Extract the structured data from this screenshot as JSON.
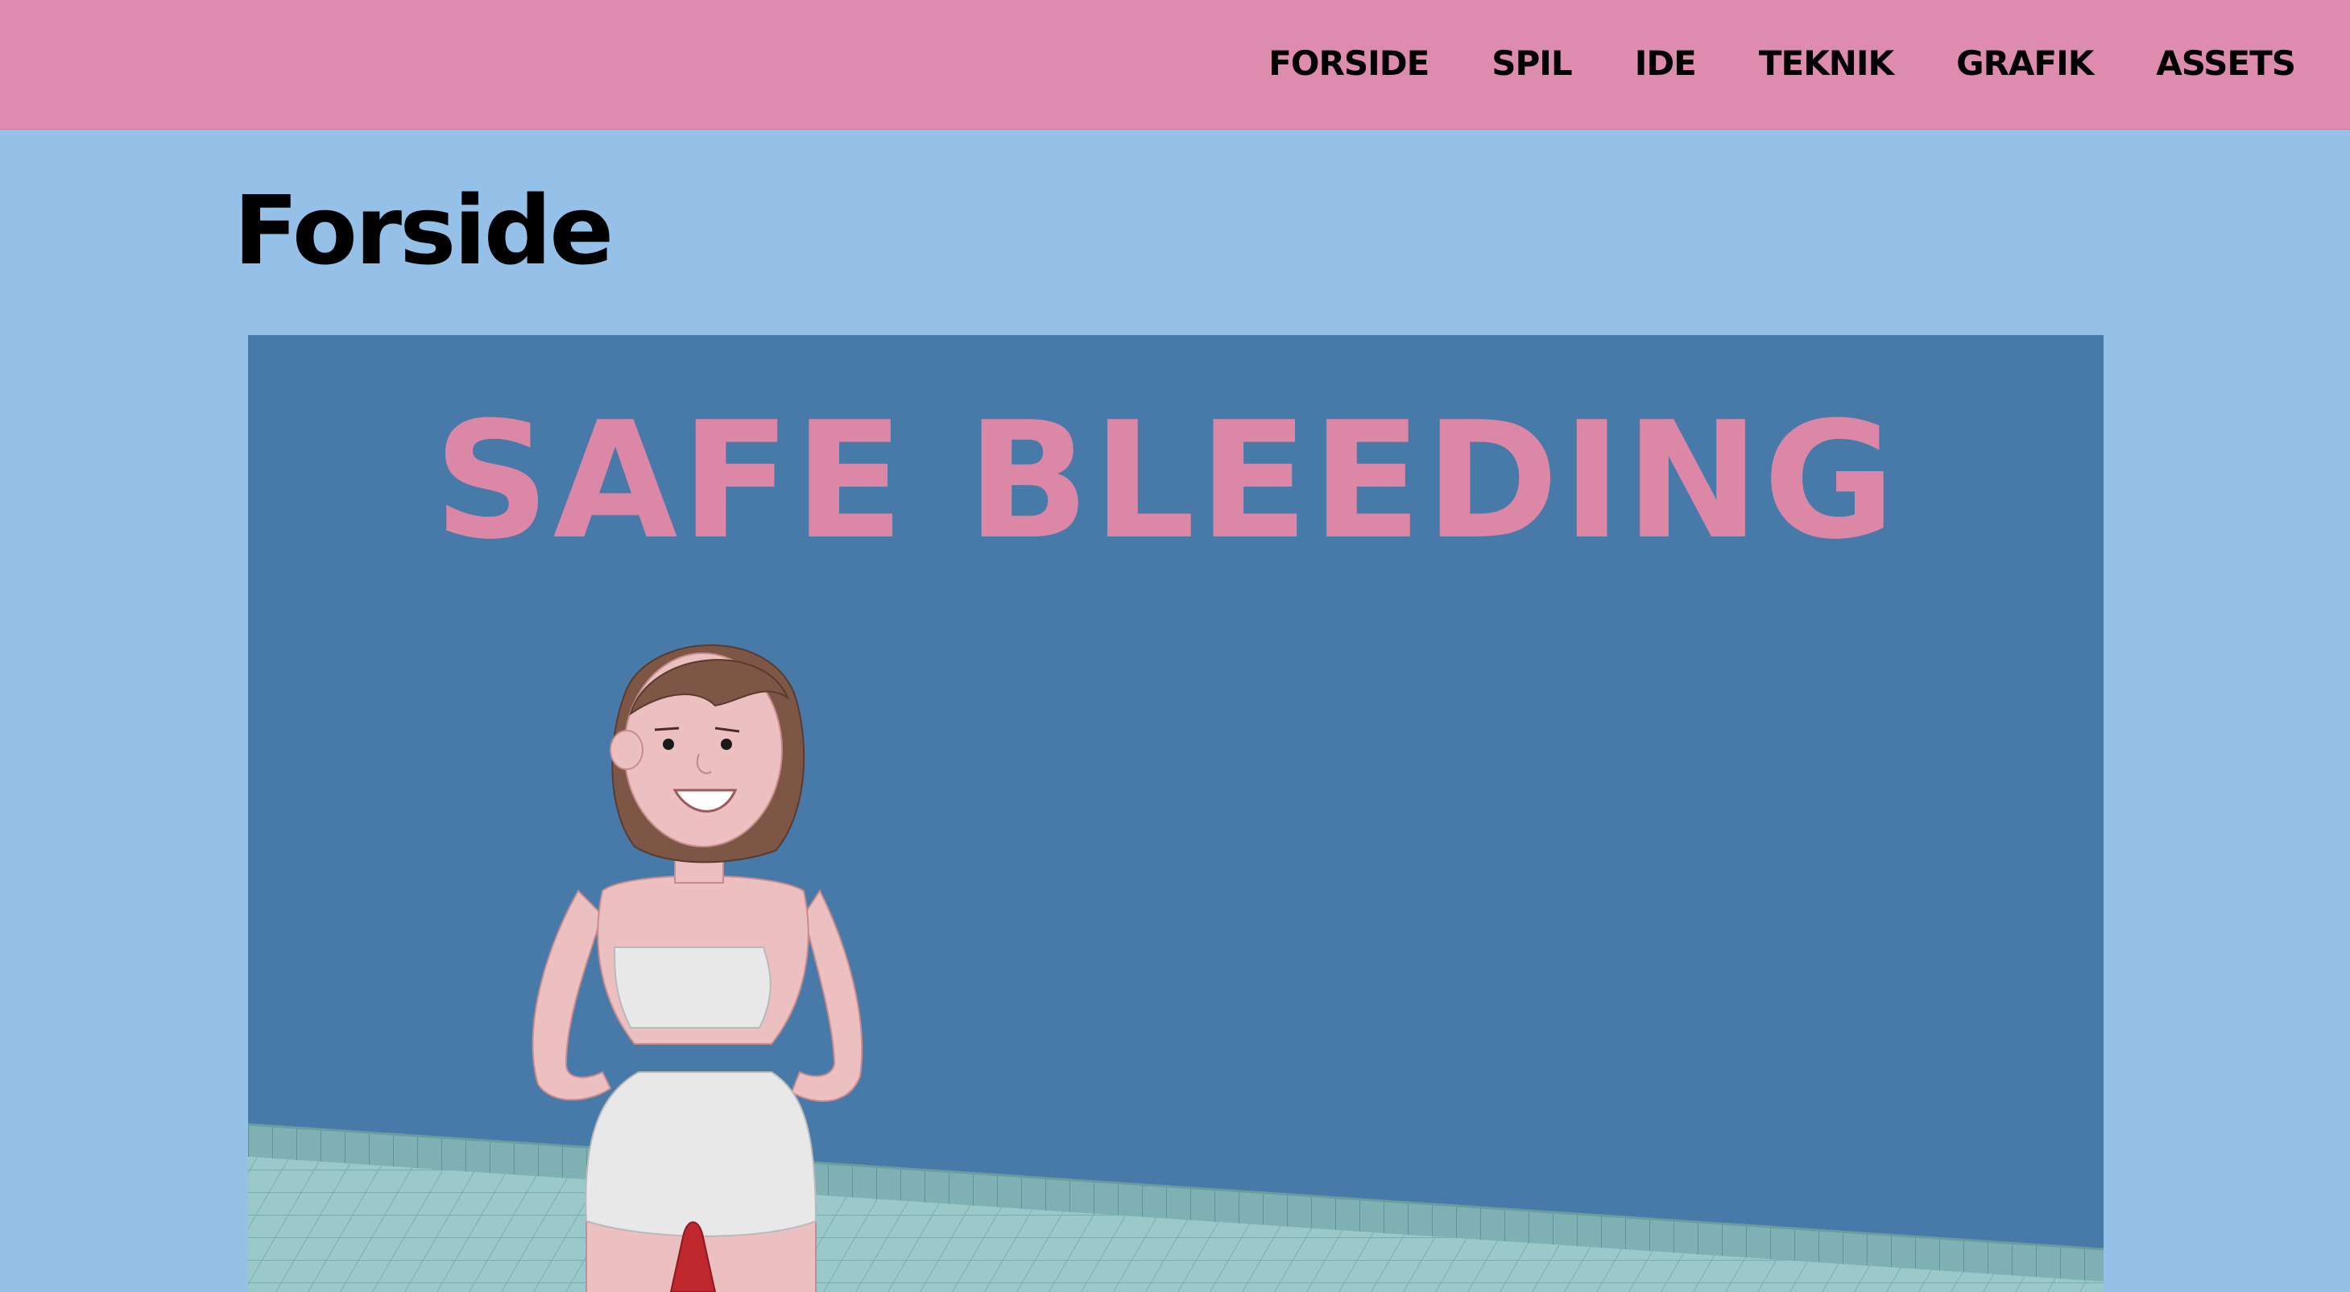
{
  "nav": {
    "items": [
      {
        "label": "FORSIDE"
      },
      {
        "label": "SPIL"
      },
      {
        "label": "IDE"
      },
      {
        "label": "TEKNIK"
      },
      {
        "label": "GRAFIK"
      },
      {
        "label": "ASSETS"
      }
    ]
  },
  "page": {
    "title": "Forside"
  },
  "hero": {
    "title": "SAFE BLEEDING"
  },
  "colors": {
    "header_bg": "#de8cad",
    "page_bg": "#95c1e9",
    "hero_bg": "#477aa9",
    "hero_title": "#dc87a5",
    "tiles": "#9bc8c9"
  }
}
